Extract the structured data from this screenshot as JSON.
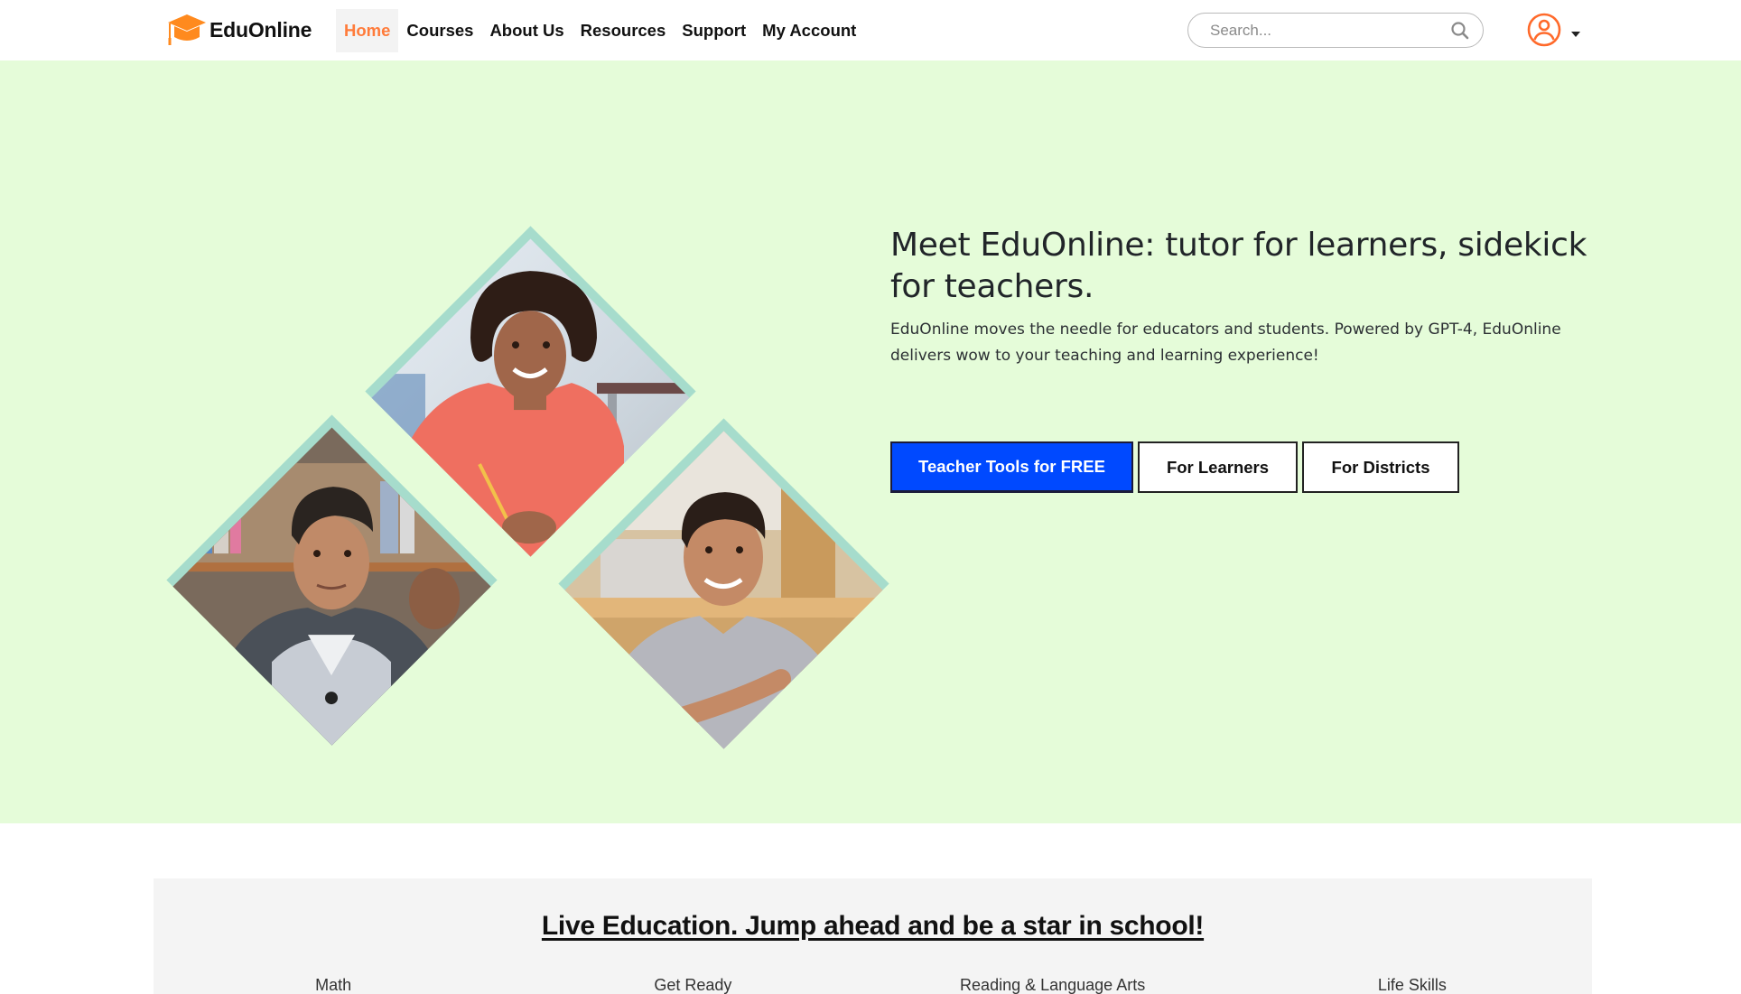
{
  "brand": {
    "name": "EduOnline",
    "icon": "graduation-cap-icon",
    "accent_color": "#ff7b3a"
  },
  "nav": {
    "items": [
      {
        "label": "Home",
        "active": true
      },
      {
        "label": "Courses",
        "active": false
      },
      {
        "label": "About Us",
        "active": false
      },
      {
        "label": "Resources",
        "active": false
      },
      {
        "label": "Support",
        "active": false
      },
      {
        "label": "My Account",
        "active": false
      }
    ]
  },
  "search": {
    "placeholder": "Search...",
    "value": "",
    "icon": "search-icon"
  },
  "user_menu": {
    "icon": "user-circle-icon",
    "dropdown_icon": "caret-down-icon"
  },
  "hero": {
    "background_color": "#e5fcd9",
    "title": "Meet EduOnline: tutor for learners, sidekick for teachers.",
    "subtitle": "EduOnline moves the needle for educators and students. Powered by GPT-4, EduOnline delivers wow to your teaching and learning experience!",
    "images": [
      {
        "alt": "Smiling teacher in coral blouse"
      },
      {
        "alt": "Student in grey hoodie in library"
      },
      {
        "alt": "Smiling student in grey t-shirt"
      }
    ],
    "buttons": {
      "primary": "Teacher Tools for FREE",
      "learners": "For Learners",
      "districts": "For Districts"
    },
    "primary_color": "#0049ff"
  },
  "section": {
    "title": "Live Education. Jump ahead and be a star in school!",
    "categories": [
      "Math",
      "Get Ready",
      "Reading & Language Arts",
      "Life Skills"
    ]
  }
}
